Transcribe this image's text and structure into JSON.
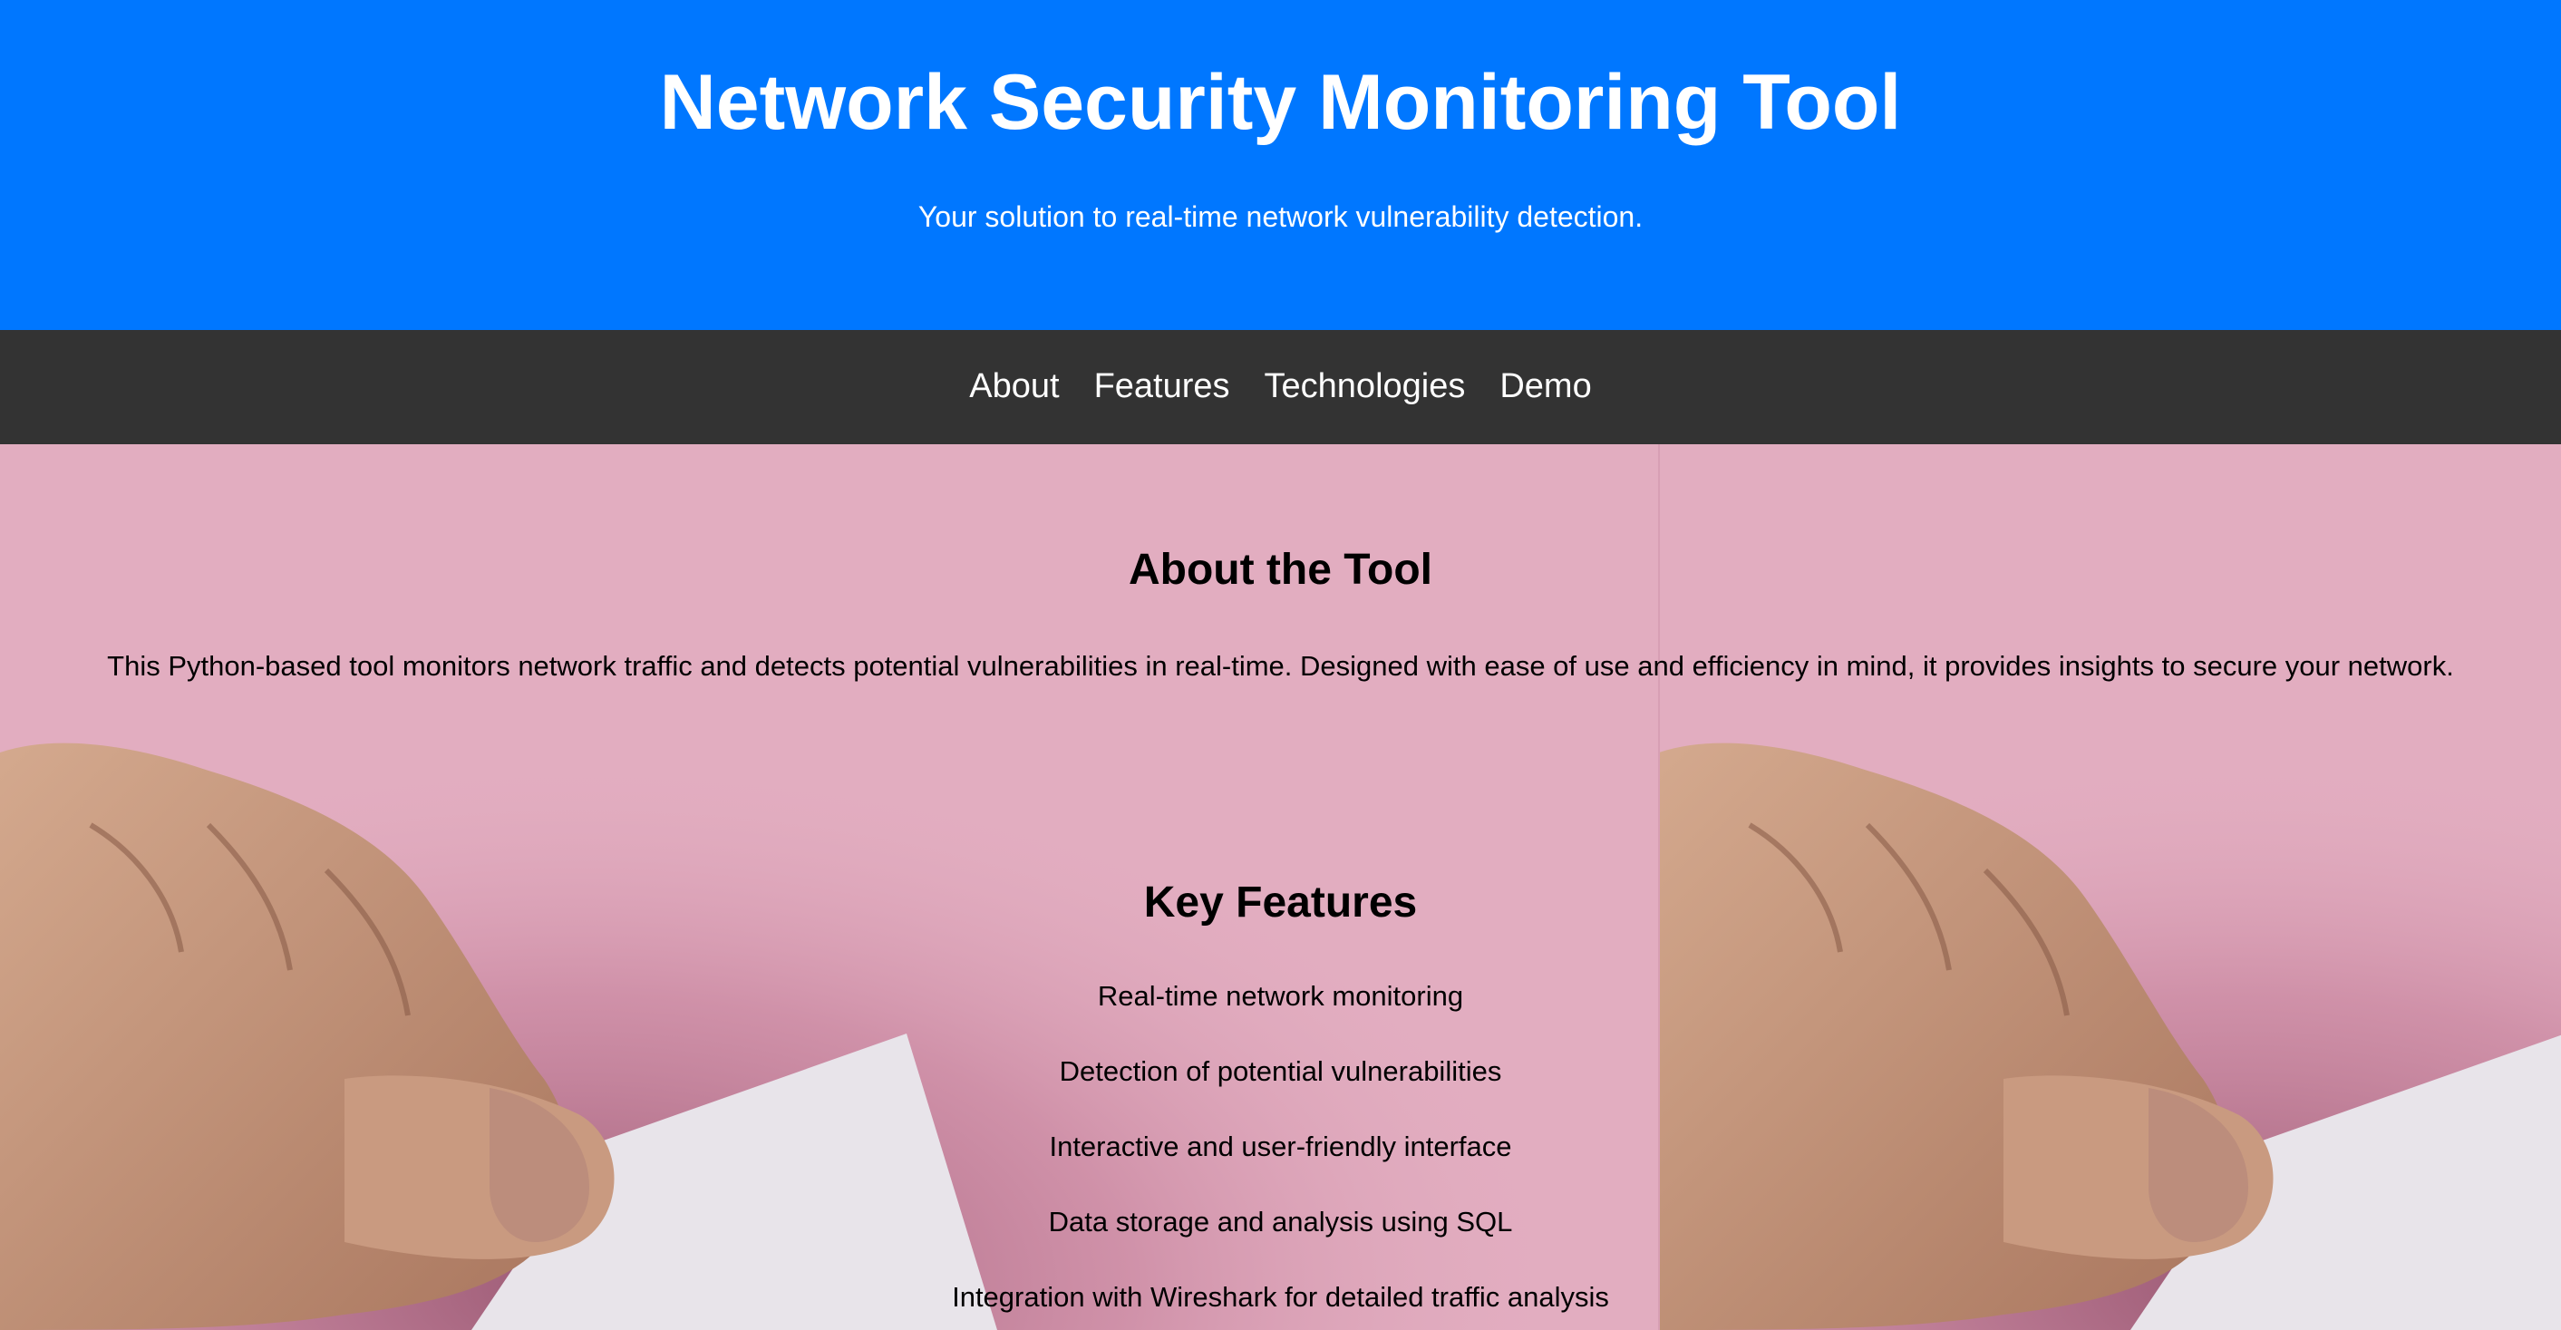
{
  "header": {
    "title": "Network Security Monitoring Tool",
    "tagline": "Your solution to real-time network vulnerability detection.",
    "background_color": "#0077ff"
  },
  "nav": {
    "background_color": "#333333",
    "items": [
      {
        "label": "About"
      },
      {
        "label": "Features"
      },
      {
        "label": "Technologies"
      },
      {
        "label": "Demo"
      }
    ]
  },
  "about": {
    "heading": "About the Tool",
    "text": "This Python-based tool monitors network traffic and detects potential vulnerabilities in real-time. Designed with ease of use and efficiency in mind, it provides insights to secure your network."
  },
  "features": {
    "heading": "Key Features",
    "items": [
      "Real-time network monitoring",
      "Detection of potential vulnerabilities",
      "Interactive and user-friendly interface",
      "Data storage and analysis using SQL",
      "Integration with Wireshark for detailed traffic analysis"
    ]
  },
  "background_image": {
    "icon": "hand-holding-paper-photo",
    "colors": {
      "pink": "#e2adc0",
      "skin": "#c89a80",
      "paper": "#e8e4ea"
    }
  }
}
